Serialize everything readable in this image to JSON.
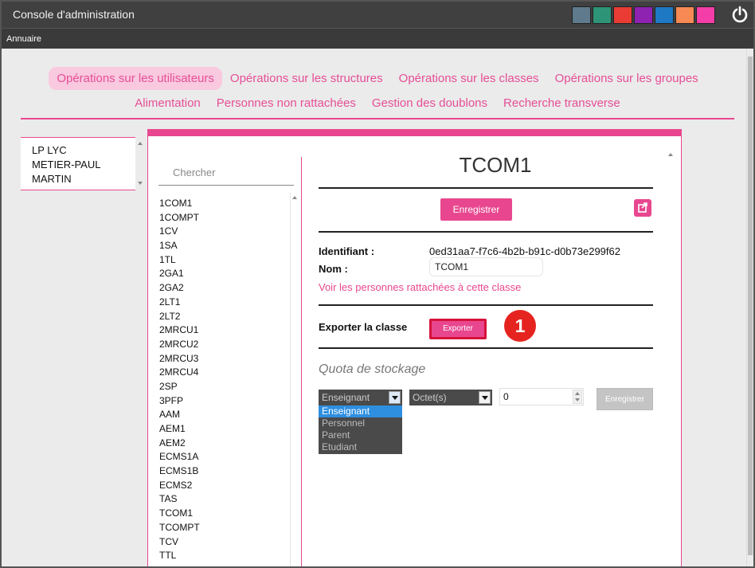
{
  "app": {
    "title": "Console d'administration",
    "menu_label": "Annuaire",
    "theme_colors": [
      "#5f7a8c",
      "#2e9477",
      "#ea3c34",
      "#8e23b2",
      "#1e78c4",
      "#f78954",
      "#f43da8"
    ]
  },
  "tabs_row1": [
    "Opérations sur les utilisateurs",
    "Opérations sur les structures",
    "Opérations sur les classes",
    "Opérations sur les groupes"
  ],
  "tabs_row2": [
    "Alimentation",
    "Personnes non rattachées",
    "Gestion des doublons",
    "Recherche transverse"
  ],
  "active_tab": "Opérations sur les utilisateurs",
  "school": {
    "lines": [
      "LP LYC",
      "METIER-PAUL",
      "MARTIN"
    ]
  },
  "class_panel": {
    "search_placeholder": "Chercher",
    "classes": [
      "1COM1",
      "1COMPT",
      "1CV",
      "1SA",
      "1TL",
      "2GA1",
      "2GA2",
      "2LT1",
      "2LT2",
      "2MRCU1",
      "2MRCU2",
      "2MRCU3",
      "2MRCU4",
      "2SP",
      "3PFP",
      "AAM",
      "AEM1",
      "AEM2",
      "ECMS1A",
      "ECMS1B",
      "ECMS2",
      "TAS",
      "TCOM1",
      "TCOMPT",
      "TCV",
      "TTL"
    ]
  },
  "detail": {
    "title": "TCOM1",
    "save_label": "Enregistrer",
    "identifiant_label": "Identifiant :",
    "identifiant_value": "0ed31aa7-f7c6-4b2b-b91c-d0b73e299f62",
    "nom_label": "Nom :",
    "nom_value": "TCOM1",
    "link_label": "Voir les personnes rattachées à cette classe",
    "export_label": "Exporter la classe",
    "export_button": "Exporter",
    "step_number": "1",
    "quota_title": "Quota de stockage",
    "profile_select": "Enseignant",
    "profile_options": [
      "Enseignant",
      "Personnel",
      "Parent",
      "Etudiant"
    ],
    "unit_select": "Octet(s)",
    "quota_value": "0",
    "quota_save": "Enregistrer"
  }
}
